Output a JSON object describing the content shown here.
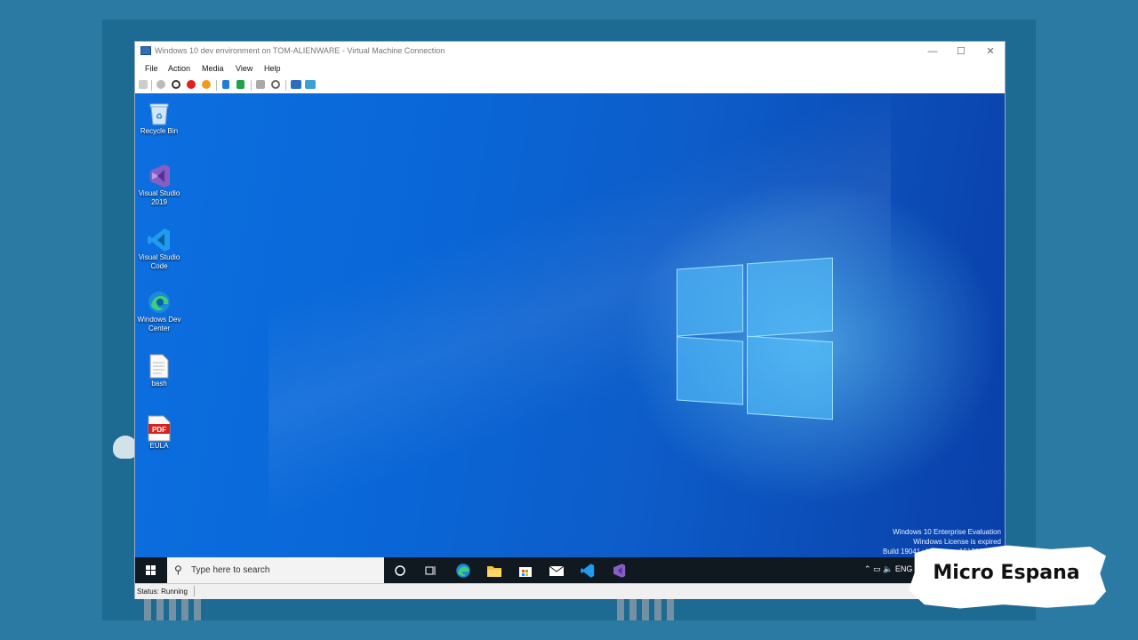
{
  "window": {
    "title": "Windows 10 dev environment on TOM-ALIENWARE - Virtual Machine Connection",
    "controls": {
      "minimize": "—",
      "maximize": "☐",
      "close": "✕"
    }
  },
  "menu": [
    "File",
    "Action",
    "Media",
    "View",
    "Help"
  ],
  "desktop_icons": [
    {
      "label": "Recycle Bin",
      "icon": "recycle-bin-icon"
    },
    {
      "label": "Visual Studio 2019",
      "icon": "visual-studio-icon"
    },
    {
      "label": "Visual Studio Code",
      "icon": "vscode-icon"
    },
    {
      "label": "Windows Dev Center",
      "icon": "edge-icon"
    },
    {
      "label": "bash",
      "icon": "document-icon"
    },
    {
      "label": "EULA",
      "icon": "pdf-icon"
    }
  ],
  "pdf_badge": "PDF",
  "watermark": {
    "line1": "Windows 10 Enterprise Evaluation",
    "line2": "Windows License is expired",
    "line3": "Build 19041.vb_release.191206-1406"
  },
  "taskbar": {
    "search_placeholder": "Type here to search",
    "tray_language": "ENG"
  },
  "status": {
    "text": "Status: Running"
  },
  "brand": {
    "text": "Micro Espana"
  },
  "colors": {
    "accent": "#0a66d6",
    "taskbar": "#101820",
    "host_bg": "#2a7aa3"
  }
}
